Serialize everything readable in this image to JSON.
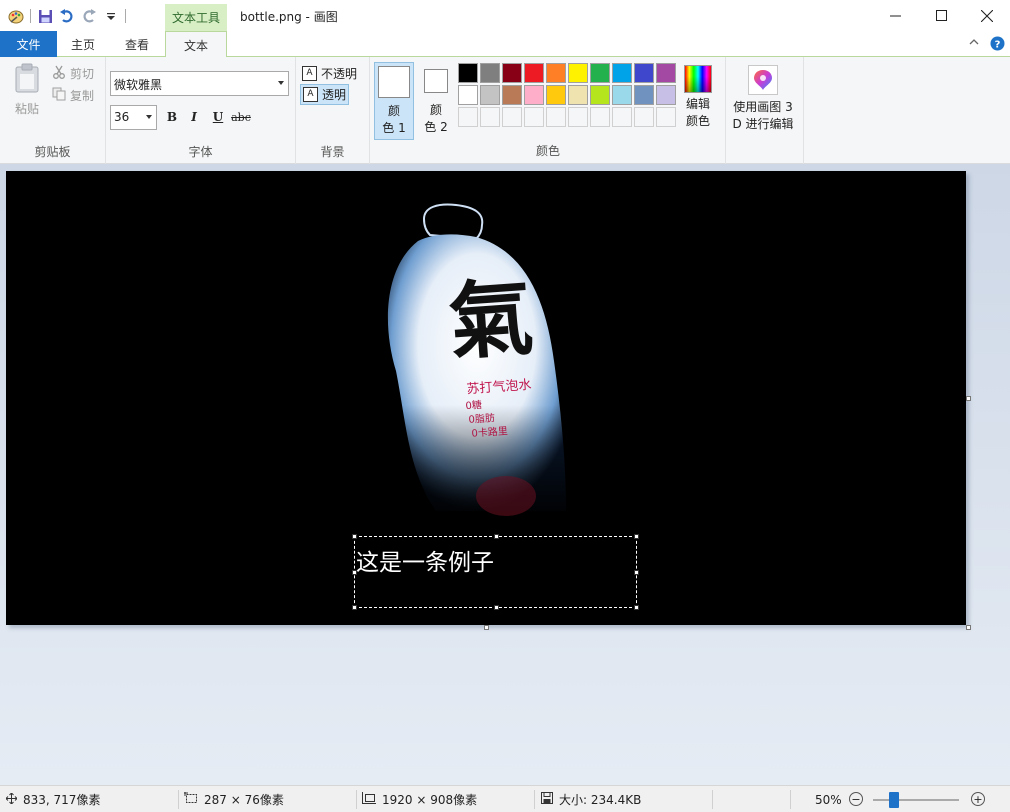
{
  "window": {
    "contextual_tab_header": "文本工具",
    "title": "bottle.png - 画图"
  },
  "tabs": {
    "file": "文件",
    "home": "主页",
    "view": "查看",
    "text": "文本"
  },
  "ribbon": {
    "clipboard": {
      "paste": "粘贴",
      "cut": "剪切",
      "copy": "复制",
      "label": "剪贴板"
    },
    "font": {
      "family": "微软雅黑",
      "size": "36",
      "bold": "B",
      "italic": "I",
      "underline": "U",
      "strikethrough": "abc",
      "label": "字体"
    },
    "background": {
      "opaque": "不透明",
      "transparent": "透明",
      "label": "背景"
    },
    "colors": {
      "color1_line1": "颜",
      "color1_line2": "色 1",
      "color2_line1": "颜",
      "color2_line2": "色 2",
      "edit_line1": "编辑",
      "edit_line2": "颜色",
      "label": "颜色",
      "color1_value": "#ffffff",
      "color2_value": "#ffffff",
      "palette_row1": [
        "#000000",
        "#7f7f7f",
        "#880015",
        "#ed1c24",
        "#ff7f27",
        "#fff200",
        "#22b14c",
        "#00a2e8",
        "#3f48cc",
        "#a349a4"
      ],
      "palette_row2": [
        "#ffffff",
        "#c3c3c3",
        "#b97a57",
        "#ffaec9",
        "#ffc90e",
        "#efe4b0",
        "#b5e61d",
        "#99d9ea",
        "#7092be",
        "#c8bfe7"
      ]
    },
    "paint3d": {
      "line1": "使用画图 3",
      "line2": "D 进行编辑"
    }
  },
  "canvas": {
    "textbox_text": "这是一条例子",
    "bottle": {
      "logo": "氣",
      "product": "苏打气泡水",
      "claims": [
        "0糖",
        "0脂肪",
        "0卡路里"
      ]
    }
  },
  "status": {
    "cursor": "833, 717像素",
    "selection": "287 × 76像素",
    "image_size": "1920 × 908像素",
    "file_size": "大小: 234.4KB",
    "zoom": "50%"
  },
  "accent_color": "#1e73c8"
}
